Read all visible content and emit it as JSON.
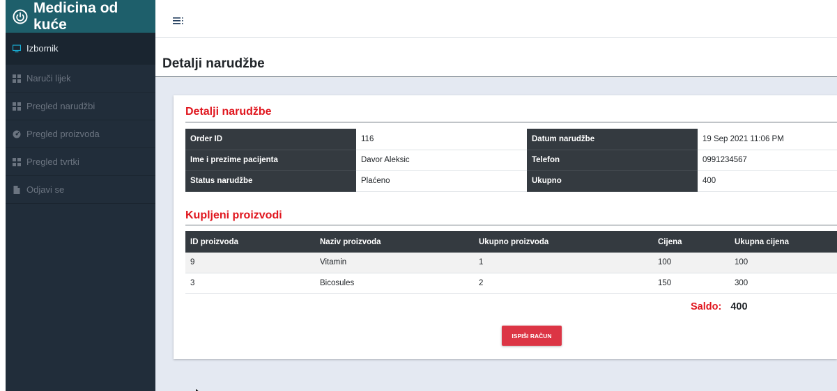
{
  "brand": {
    "title": "Medicina od kuće"
  },
  "sidebar": {
    "items": [
      {
        "label": "Izbornik",
        "icon": "monitor-icon",
        "active": true
      },
      {
        "label": "Naruči lijek",
        "icon": "grid-icon"
      },
      {
        "label": "Pregled narudžbi",
        "icon": "grid-icon"
      },
      {
        "label": "Pregled proizvoda",
        "icon": "dashboard-icon"
      },
      {
        "label": "Pregled tvrtki",
        "icon": "grid-icon"
      },
      {
        "label": "Odjavi se",
        "icon": "file-icon"
      }
    ]
  },
  "page": {
    "title": "Detalji narudžbe"
  },
  "order": {
    "section_title": "Detalji narudžbe",
    "rows": [
      {
        "label1": "Order ID",
        "value1": "116",
        "label2": "Datum narudžbe",
        "value2": "19 Sep 2021 11:06 PM"
      },
      {
        "label1": "Ime i prezime pacijenta",
        "value1": "Davor Aleksic",
        "label2": "Telefon",
        "value2": "0991234567"
      },
      {
        "label1": "Status narudžbe",
        "value1": "Plaćeno",
        "label2": "Ukupno",
        "value2": "400"
      }
    ]
  },
  "products": {
    "section_title": "Kupljeni proizvodi",
    "columns": [
      "ID proizvoda",
      "Naziv proizvoda",
      "Ukupno proizvoda",
      "Cijena",
      "Ukupna cijena"
    ],
    "rows": [
      [
        "9",
        "Vitamin",
        "1",
        "100",
        "100"
      ],
      [
        "3",
        "Bicosules",
        "2",
        "150",
        "300"
      ]
    ]
  },
  "saldo": {
    "label": "Saldo:",
    "value": "400"
  },
  "actions": {
    "print_label": "ISPIŠI RAČUN"
  },
  "colors": {
    "brand": "#1e5f6b",
    "sidebar": "#212d3a",
    "accent_red": "#e0161e",
    "button": "#dc3545",
    "table_header": "#343a40"
  }
}
